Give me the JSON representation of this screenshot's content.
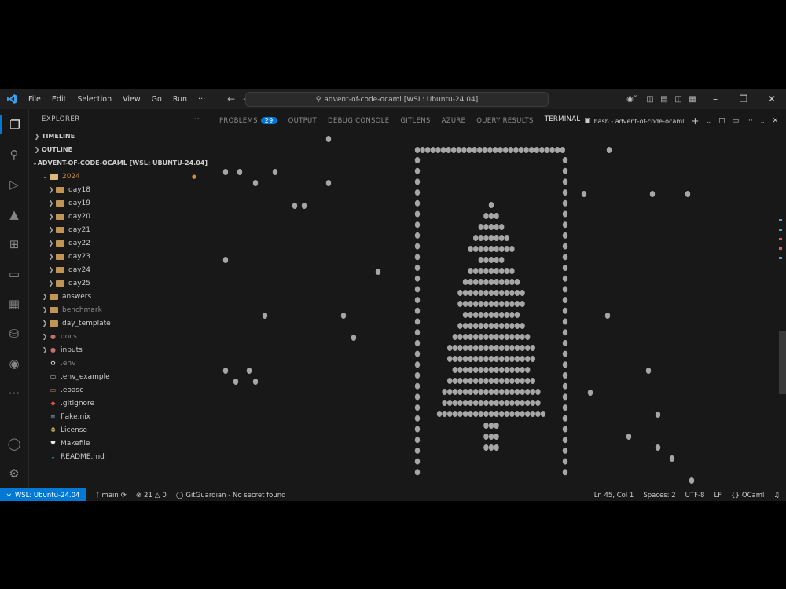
{
  "titlebar": {
    "menu": [
      "File",
      "Edit",
      "Selection",
      "View",
      "Go",
      "Run",
      "···"
    ],
    "search_text": "advent-of-code-ocaml [WSL: Ubuntu-24.04]"
  },
  "explorer": {
    "title": "EXPLORER",
    "more": "···",
    "sections": {
      "timeline": "TIMELINE",
      "outline": "OUTLINE",
      "workspace": "ADVENT-OF-CODE-OCAML [WSL: UBUNTU-24.04]"
    },
    "year_folder": "2024",
    "year_status": "●",
    "days": [
      "day18",
      "day19",
      "day20",
      "day21",
      "day22",
      "day23",
      "day24",
      "day25"
    ],
    "folders": [
      "answers",
      "benchmark",
      "day_template"
    ],
    "dim_folder": "docs",
    "inputs_folder": "inputs",
    "files": [
      ".env",
      ".env_example",
      ".eoasc",
      ".gitignore",
      "flake.nix",
      "License",
      "Makefile",
      "README.md"
    ]
  },
  "panel": {
    "tabs": [
      "PROBLEMS",
      "OUTPUT",
      "DEBUG CONSOLE",
      "GITLENS",
      "AZURE",
      "QUERY RESULTS",
      "TERMINAL"
    ],
    "problems_count": "29",
    "terminal_name": "bash - advent-of-code-ocaml"
  },
  "statusbar": {
    "remote": "WSL: Ubuntu-24.04",
    "branch": "main",
    "errors": "21",
    "warnings": "0",
    "gitguardian": "GitGuardian - No secret found",
    "position": "Ln 45, Col 1",
    "spaces": "Spaces: 2",
    "encoding": "UTF-8",
    "eol": "LF",
    "language": "OCaml"
  },
  "colors": {
    "accent": "#0078d4",
    "background": "#181818",
    "glyph": "#a6a6a6"
  }
}
